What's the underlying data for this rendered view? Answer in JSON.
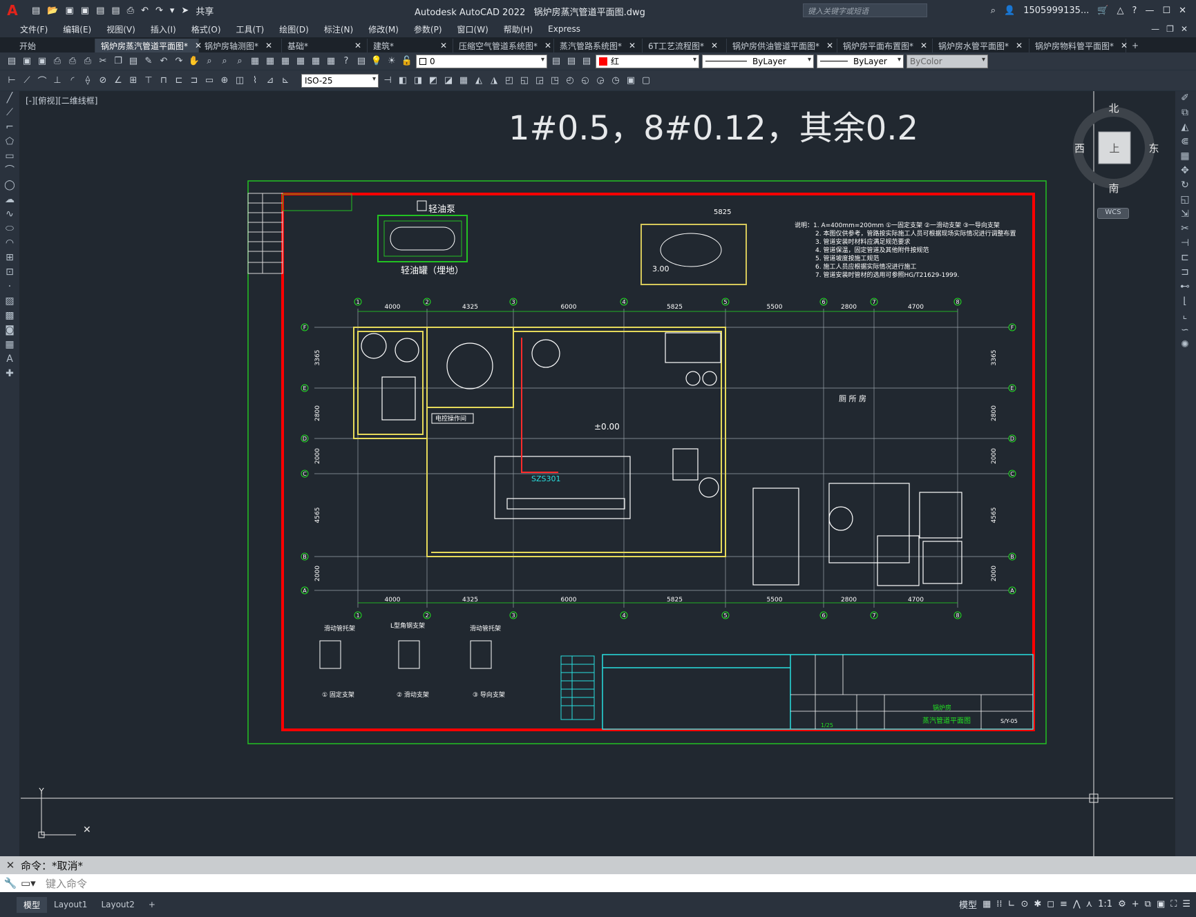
{
  "app": {
    "title": "Autodesk AutoCAD 2022",
    "file": "锅炉房蒸汽管道平面图.dwg",
    "share": "共享",
    "search_placeholder": "键入关键字或短语",
    "user": "1505999135...",
    "help": "?"
  },
  "menus": [
    "文件(F)",
    "编辑(E)",
    "视图(V)",
    "插入(I)",
    "格式(O)",
    "工具(T)",
    "绘图(D)",
    "标注(N)",
    "修改(M)",
    "参数(P)",
    "窗口(W)",
    "帮助(H)",
    "Express"
  ],
  "tabs": [
    {
      "label": "开始",
      "closable": false
    },
    {
      "label": "锅炉房蒸汽管道平面图*",
      "closable": true,
      "active": true
    },
    {
      "label": "锅炉房轴测图*",
      "closable": true
    },
    {
      "label": "基础*",
      "closable": true
    },
    {
      "label": "建筑*",
      "closable": true
    },
    {
      "label": "压缩空气管道系统图*",
      "closable": true
    },
    {
      "label": "蒸汽管路系统图*",
      "closable": true
    },
    {
      "label": "6T工艺流程图*",
      "closable": true
    },
    {
      "label": "锅炉房供油管道平面图*",
      "closable": true
    },
    {
      "label": "锅炉房平面布置图*",
      "closable": true
    },
    {
      "label": "锅炉房水管平面图*",
      "closable": true
    },
    {
      "label": "锅炉房物料管平面图*",
      "closable": true
    }
  ],
  "properties": {
    "layer": "0",
    "color": "红",
    "linetype": "ByLayer",
    "lineweight": "ByLayer",
    "plotstyle": "ByColor",
    "dimstyle": "ISO-25",
    "color_hex": "#ff0000"
  },
  "viewport": {
    "label": "[-][俯视][二维线框]"
  },
  "viewcube": {
    "north": "北",
    "south": "南",
    "east": "东",
    "west": "西",
    "top": "上",
    "wcs": "WCS"
  },
  "drawing": {
    "heading": "1#0.5，8#0.12，其余0.2",
    "title_block": {
      "drawing_name": "蒸汽管道平面图",
      "project": "锅炉房",
      "scale": "1/25",
      "number": "S/Y-05"
    },
    "labels": {
      "pump": "轻油泵",
      "tank": "轻油罐（埋地）",
      "control_room": "电控操作间",
      "boiler": "SZS301",
      "elev_zero": "±0.00",
      "elev_300": "3.00",
      "room": "厕 所 房"
    },
    "notes": [
      "说明：1. A=400mm=200mm ①一固定支架 ②一滑动支架 ③一导向支架",
      "2. 本图仅供参考，管路按实际施工人员可根据现场实际情况进行调整布置",
      "3. 管道安装时材料应满足规范要求",
      "4. 管道保温，固定管道及其他附件按规范",
      "5. 管道坡度按施工规范",
      "6. 施工人员应根据实际情况进行施工",
      "7. 管道安装时管材的选用可参照HG/T21629-1999."
    ],
    "dims_top": [
      "4000",
      "4325",
      "6000",
      "5825",
      "5500",
      "2800",
      "4700"
    ],
    "dims_top_small": "5825",
    "axis_top": [
      "1",
      "2",
      "3",
      "4",
      "5",
      "6",
      "7",
      "8"
    ],
    "axis_left": [
      "F",
      "E",
      "D",
      "C",
      "B",
      "A"
    ],
    "dims_left": [
      "3365",
      "2800",
      "2000",
      "4565",
      "2000"
    ],
    "details": [
      "① 固定支架",
      "② 滑动支架",
      "③ 导向支架"
    ],
    "detail_titles": [
      "滑动管托架",
      "L型角钢支架",
      "滑动管托架"
    ]
  },
  "command": {
    "history": "命令：*取消*",
    "placeholder": "键入命令"
  },
  "layout_tabs": [
    "模型",
    "Layout1",
    "Layout2",
    "+"
  ],
  "status": {
    "model": "模型",
    "scale": "1:1"
  }
}
